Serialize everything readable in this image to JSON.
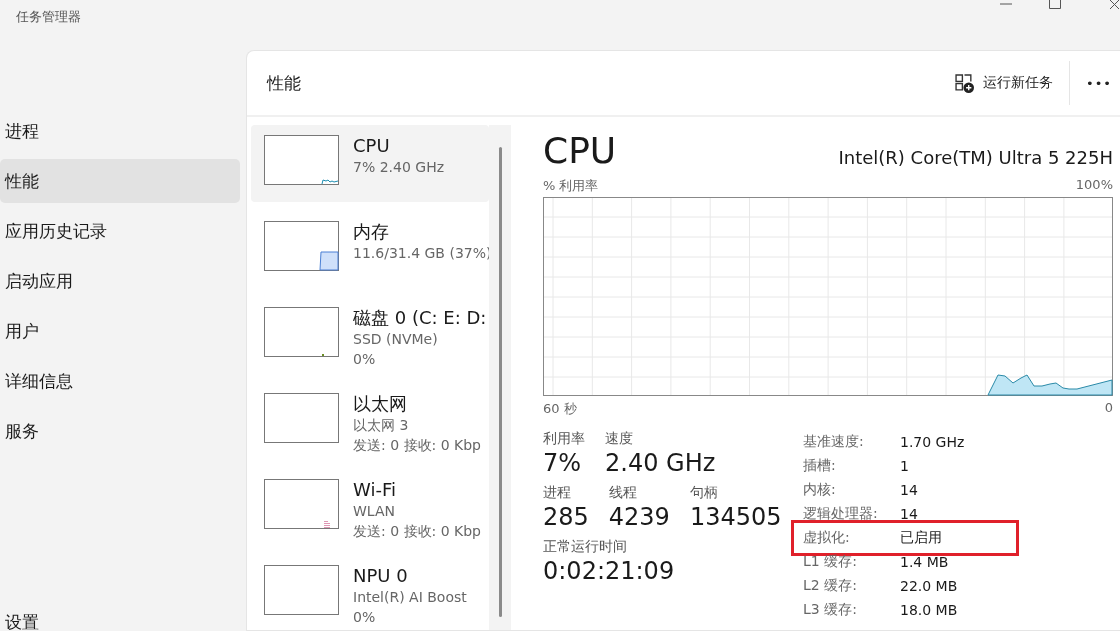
{
  "window": {
    "title": "任务管理器"
  },
  "nav": {
    "items": [
      {
        "label": "进程",
        "selected": false
      },
      {
        "label": "性能",
        "selected": true
      },
      {
        "label": "应用历史记录",
        "selected": false
      },
      {
        "label": "启动应用",
        "selected": false
      },
      {
        "label": "用户",
        "selected": false
      },
      {
        "label": "详细信息",
        "selected": false
      },
      {
        "label": "服务",
        "selected": false
      }
    ],
    "settings": "设置"
  },
  "header": {
    "title": "性能",
    "run_task": "运行新任务",
    "more": "•••"
  },
  "devices": [
    {
      "name": "CPU",
      "lines": [
        "7% 2.40 GHz"
      ],
      "selected": true,
      "kind": "line"
    },
    {
      "name": "内存",
      "lines": [
        "11.6/31.4 GB (37%)"
      ],
      "selected": false,
      "kind": "fill"
    },
    {
      "name": "磁盘 0 (C: E: D:",
      "lines": [
        "SSD (NVMe)",
        "0%"
      ],
      "selected": false,
      "kind": "dot"
    },
    {
      "name": "以太网",
      "lines": [
        "以太网 3",
        "发送: 0 接收: 0 Kbp"
      ],
      "selected": false,
      "kind": "empty"
    },
    {
      "name": "Wi-Fi",
      "lines": [
        "WLAN",
        "发送: 0 接收: 0 Kbp"
      ],
      "selected": false,
      "kind": "spike"
    },
    {
      "name": "NPU 0",
      "lines": [
        "Intel(R) AI Boost",
        "0%"
      ],
      "selected": false,
      "kind": "empty"
    }
  ],
  "detail": {
    "title": "CPU",
    "model": "Intel(R) Core(TM) Ultra 5 225H",
    "graph": {
      "ylabel": "% 利用率",
      "ymax": "100%",
      "xstart": "60 秒",
      "xend": "0"
    },
    "stats": [
      [
        {
          "label": "利用率",
          "value": "7%"
        },
        {
          "label": "速度",
          "value": "2.40 GHz"
        }
      ],
      [
        {
          "label": "进程",
          "value": "285"
        },
        {
          "label": "线程",
          "value": "4239"
        },
        {
          "label": "句柄",
          "value": "134505"
        }
      ],
      [
        {
          "label": "正常运行时间",
          "value": "0:02:21:09"
        }
      ]
    ],
    "specs": [
      {
        "label": "基准速度:",
        "value": "1.70 GHz",
        "highlighted": false
      },
      {
        "label": "插槽:",
        "value": "1",
        "highlighted": false
      },
      {
        "label": "内核:",
        "value": "14",
        "highlighted": false
      },
      {
        "label": "逻辑处理器:",
        "value": "14",
        "highlighted": false
      },
      {
        "label": "虚拟化:",
        "value": "已启用",
        "highlighted": true
      },
      {
        "label": "L1 缓存:",
        "value": "1.4 MB",
        "highlighted": false
      },
      {
        "label": "L2 缓存:",
        "value": "22.0 MB",
        "highlighted": false
      },
      {
        "label": "L3 缓存:",
        "value": "18.0 MB",
        "highlighted": false
      }
    ]
  }
}
